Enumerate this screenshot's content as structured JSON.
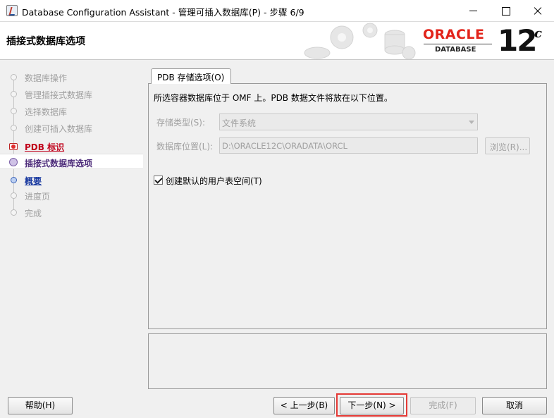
{
  "window": {
    "title": "Database Configuration Assistant - 管理可插入数据库(P) - 步骤 6/9"
  },
  "banner": {
    "step_title": "插接式数据库选项",
    "brand_name": "ORACLE",
    "brand_product": "DATABASE",
    "version": "12",
    "version_suffix": "c"
  },
  "nav": {
    "items": [
      {
        "label": "数据库操作",
        "state": "done"
      },
      {
        "label": "管理插接式数据库",
        "state": "done"
      },
      {
        "label": "选择数据库",
        "state": "done"
      },
      {
        "label": "创建可插入数据库",
        "state": "done"
      },
      {
        "label": "PDB 标识",
        "state": "warning"
      },
      {
        "label": "插接式数据库选项",
        "state": "current"
      },
      {
        "label": "概要",
        "state": "link"
      },
      {
        "label": "进度页",
        "state": "pending"
      },
      {
        "label": "完成",
        "state": "pending"
      }
    ]
  },
  "content": {
    "tab_label": "PDB 存储选项(O)",
    "description": "所选容器数据库位于 OMF 上。PDB 数据文件将放在以下位置。",
    "storage_type_label": "存储类型(S):",
    "storage_type_value": "文件系统",
    "location_label": "数据库位置(L):",
    "location_value": "D:\\ORACLE12C\\ORADATA\\ORCL",
    "browse_label": "浏览(R)...",
    "checkbox_label": "创建默认的用户表空间(T)",
    "checkbox_checked": true
  },
  "footer": {
    "help_label": "帮助(H)",
    "back_label": "< 上一步(B)",
    "next_label": "下一步(N) >",
    "finish_label": "完成(F)",
    "cancel_label": "取消"
  },
  "colors": {
    "brand_red": "#e2231a",
    "highlight": "#e53935",
    "current_step": "#4d2c7a",
    "link_step": "#1a3aa0",
    "warning_step": "#c0001a"
  }
}
